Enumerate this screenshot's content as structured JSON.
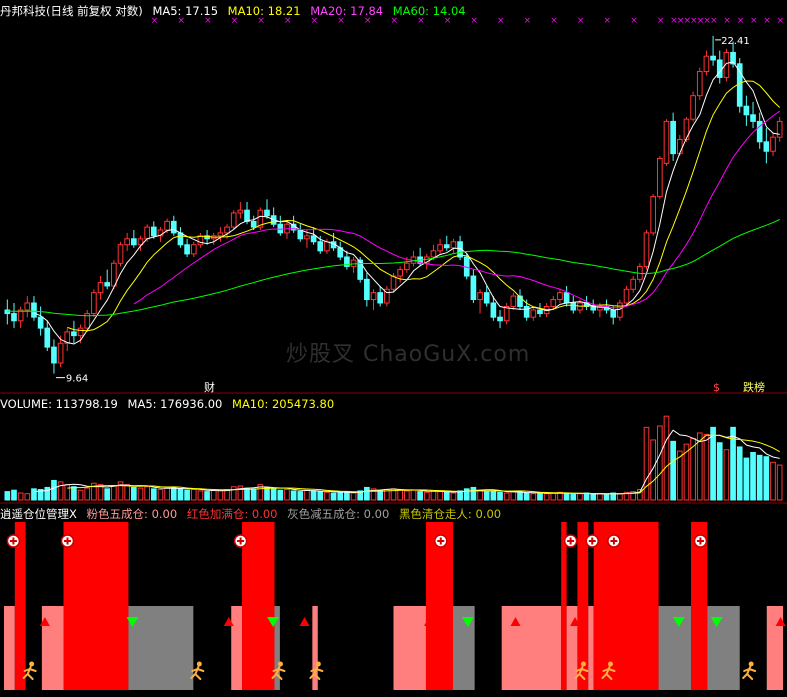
{
  "header": {
    "price_title": "丹邦科技(日线 前复权 对数)",
    "ma5": "MA5: 17.15",
    "ma10": "MA10: 18.21",
    "ma20": "MA20: 17.84",
    "ma60": "MA60: 14.04",
    "vol_title": "VOLUME: 113798.19",
    "vol_ma5": "MA5: 176936.00",
    "vol_ma10": "MA10: 205473.80",
    "ind_title": "逍遥仓位管理X",
    "ind_pink": "粉色五成仓: 0.00",
    "ind_red": "红色加满仓: 0.00",
    "ind_gray": "灰色减五成仓: 0.00",
    "ind_black": "黑色清仓走人: 0.00"
  },
  "colors": {
    "ma5": "#ffffff",
    "ma10": "#ffff00",
    "ma20": "#ff00ff",
    "ma60": "#00ff00",
    "up": "#ff3333",
    "down": "#54ffff",
    "pink": "#ff7f7f",
    "red": "#ff0000",
    "gray": "#808080",
    "divider": "#8b0000"
  },
  "chart_data": {
    "type": "candlestick",
    "scale": "log",
    "annotations": {
      "high_label": "22.41",
      "low_label": "9.64",
      "fin_label": "财",
      "dollar_label": "$",
      "tag_label": "跌榜",
      "watermark": "炒股叉 ChaoGuX.com"
    },
    "candles": [
      [
        11.3,
        11.6,
        10.9,
        11.2
      ],
      [
        11.2,
        11.5,
        10.8,
        11.0
      ],
      [
        11.0,
        11.4,
        10.8,
        11.3
      ],
      [
        11.3,
        11.7,
        11.1,
        11.5
      ],
      [
        11.5,
        11.7,
        11.0,
        11.1
      ],
      [
        11.1,
        11.4,
        10.6,
        10.8
      ],
      [
        10.8,
        11.0,
        10.2,
        10.3
      ],
      [
        10.3,
        10.5,
        9.64,
        9.9
      ],
      [
        9.9,
        10.6,
        9.8,
        10.4
      ],
      [
        10.4,
        10.8,
        10.2,
        10.7
      ],
      [
        10.7,
        11.0,
        10.4,
        10.6
      ],
      [
        10.6,
        10.9,
        10.4,
        10.8
      ],
      [
        10.8,
        11.3,
        10.7,
        11.2
      ],
      [
        11.2,
        11.9,
        11.1,
        11.8
      ],
      [
        11.8,
        12.3,
        11.6,
        12.1
      ],
      [
        12.1,
        12.5,
        11.9,
        12.0
      ],
      [
        12.0,
        12.8,
        11.9,
        12.7
      ],
      [
        12.7,
        13.4,
        12.6,
        13.3
      ],
      [
        13.3,
        13.7,
        13.1,
        13.5
      ],
      [
        13.5,
        13.8,
        13.2,
        13.3
      ],
      [
        13.3,
        13.6,
        13.1,
        13.5
      ],
      [
        13.5,
        14.0,
        13.4,
        13.9
      ],
      [
        13.9,
        14.1,
        13.5,
        13.6
      ],
      [
        13.6,
        13.9,
        13.4,
        13.8
      ],
      [
        13.8,
        14.2,
        13.7,
        14.1
      ],
      [
        14.1,
        14.3,
        13.6,
        13.7
      ],
      [
        13.7,
        13.9,
        13.2,
        13.3
      ],
      [
        13.3,
        13.5,
        12.9,
        13.0
      ],
      [
        13.0,
        13.4,
        12.9,
        13.3
      ],
      [
        13.3,
        13.7,
        13.2,
        13.6
      ],
      [
        13.6,
        13.8,
        13.3,
        13.5
      ],
      [
        13.5,
        13.7,
        13.3,
        13.6
      ],
      [
        13.6,
        13.9,
        13.4,
        13.7
      ],
      [
        13.7,
        14.0,
        13.5,
        13.9
      ],
      [
        13.9,
        14.5,
        13.8,
        14.4
      ],
      [
        14.4,
        14.8,
        14.2,
        14.5
      ],
      [
        14.5,
        14.8,
        14.0,
        14.1
      ],
      [
        14.1,
        14.3,
        13.8,
        13.9
      ],
      [
        13.9,
        14.6,
        13.8,
        14.5
      ],
      [
        14.5,
        14.9,
        14.2,
        14.3
      ],
      [
        14.3,
        14.6,
        13.9,
        14.0
      ],
      [
        14.0,
        14.3,
        13.6,
        13.7
      ],
      [
        13.7,
        14.1,
        13.5,
        14.0
      ],
      [
        14.0,
        14.3,
        13.7,
        13.8
      ],
      [
        13.8,
        14.0,
        13.4,
        13.5
      ],
      [
        13.5,
        13.8,
        13.2,
        13.6
      ],
      [
        13.6,
        13.9,
        13.3,
        13.4
      ],
      [
        13.4,
        13.6,
        13.0,
        13.1
      ],
      [
        13.1,
        13.5,
        13.0,
        13.4
      ],
      [
        13.4,
        13.7,
        13.1,
        13.2
      ],
      [
        13.2,
        13.4,
        12.8,
        12.9
      ],
      [
        12.9,
        13.1,
        12.5,
        12.6
      ],
      [
        12.6,
        12.9,
        12.4,
        12.8
      ],
      [
        12.8,
        12.9,
        12.1,
        12.2
      ],
      [
        12.2,
        12.4,
        11.4,
        11.6
      ],
      [
        11.6,
        11.9,
        11.3,
        11.8
      ],
      [
        11.8,
        12.0,
        11.4,
        11.5
      ],
      [
        11.5,
        12.0,
        11.4,
        11.9
      ],
      [
        11.9,
        12.4,
        11.8,
        12.3
      ],
      [
        12.3,
        12.6,
        12.1,
        12.5
      ],
      [
        12.5,
        12.9,
        12.4,
        12.7
      ],
      [
        12.7,
        13.1,
        12.6,
        12.9
      ],
      [
        12.9,
        13.2,
        12.6,
        12.7
      ],
      [
        12.7,
        13.0,
        12.5,
        12.9
      ],
      [
        12.9,
        13.3,
        12.8,
        13.1
      ],
      [
        13.1,
        13.5,
        13.0,
        13.3
      ],
      [
        13.3,
        13.6,
        13.1,
        13.2
      ],
      [
        13.2,
        13.5,
        13.0,
        13.4
      ],
      [
        13.4,
        13.6,
        12.8,
        12.9
      ],
      [
        12.9,
        13.0,
        12.2,
        12.3
      ],
      [
        12.3,
        12.5,
        11.5,
        11.6
      ],
      [
        11.6,
        11.9,
        11.2,
        11.8
      ],
      [
        11.8,
        12.0,
        11.4,
        11.5
      ],
      [
        11.5,
        11.7,
        11.0,
        11.1
      ],
      [
        11.1,
        11.3,
        10.8,
        11.0
      ],
      [
        11.0,
        11.5,
        10.9,
        11.4
      ],
      [
        11.4,
        11.8,
        11.3,
        11.7
      ],
      [
        11.7,
        11.9,
        11.3,
        11.4
      ],
      [
        11.4,
        11.6,
        11.0,
        11.1
      ],
      [
        11.1,
        11.4,
        11.0,
        11.3
      ],
      [
        11.3,
        11.5,
        11.1,
        11.2
      ],
      [
        11.2,
        11.5,
        11.1,
        11.4
      ],
      [
        11.4,
        11.7,
        11.3,
        11.6
      ],
      [
        11.6,
        11.9,
        11.5,
        11.8
      ],
      [
        11.8,
        12.0,
        11.4,
        11.5
      ],
      [
        11.5,
        11.7,
        11.2,
        11.3
      ],
      [
        11.3,
        11.6,
        11.2,
        11.5
      ],
      [
        11.5,
        11.7,
        11.3,
        11.4
      ],
      [
        11.4,
        11.6,
        11.2,
        11.3
      ],
      [
        11.3,
        11.5,
        11.1,
        11.4
      ],
      [
        11.4,
        11.6,
        11.2,
        11.3
      ],
      [
        11.3,
        11.4,
        10.9,
        11.1
      ],
      [
        11.1,
        11.6,
        11.0,
        11.5
      ],
      [
        11.5,
        12.0,
        11.4,
        11.9
      ],
      [
        11.9,
        12.3,
        11.8,
        12.2
      ],
      [
        12.2,
        12.7,
        12.1,
        12.6
      ],
      [
        12.6,
        13.8,
        12.5,
        13.7
      ],
      [
        13.7,
        15.1,
        13.6,
        15.0
      ],
      [
        15.0,
        16.6,
        14.9,
        16.5
      ],
      [
        16.3,
        18.2,
        16.2,
        18.1
      ],
      [
        18.1,
        18.5,
        16.4,
        16.7
      ],
      [
        16.7,
        17.5,
        16.6,
        17.3
      ],
      [
        17.3,
        18.3,
        17.2,
        18.2
      ],
      [
        18.2,
        19.5,
        18.1,
        19.3
      ],
      [
        19.3,
        20.7,
        19.1,
        20.5
      ],
      [
        20.5,
        21.6,
        20.3,
        21.3
      ],
      [
        21.3,
        22.41,
        20.8,
        21.1
      ],
      [
        21.1,
        21.6,
        19.9,
        20.2
      ],
      [
        20.2,
        21.7,
        20.0,
        21.5
      ],
      [
        21.5,
        22.1,
        20.7,
        20.9
      ],
      [
        20.9,
        21.2,
        18.5,
        18.8
      ],
      [
        18.8,
        19.3,
        17.9,
        18.4
      ],
      [
        18.4,
        19.0,
        17.8,
        18.1
      ],
      [
        18.1,
        18.5,
        16.9,
        17.2
      ],
      [
        17.2,
        17.8,
        16.3,
        16.8
      ],
      [
        16.8,
        17.6,
        16.6,
        17.4
      ],
      [
        17.4,
        18.3,
        17.2,
        18.1
      ]
    ],
    "volume": [
      60,
      70,
      50,
      45,
      80,
      75,
      90,
      140,
      130,
      110,
      95,
      70,
      85,
      120,
      110,
      80,
      100,
      130,
      110,
      90,
      85,
      95,
      80,
      75,
      85,
      90,
      80,
      70,
      75,
      65,
      60,
      70,
      65,
      75,
      95,
      100,
      85,
      80,
      110,
      90,
      80,
      70,
      75,
      65,
      60,
      70,
      65,
      60,
      55,
      50,
      55,
      60,
      50,
      65,
      90,
      80,
      70,
      75,
      80,
      70,
      65,
      70,
      60,
      55,
      65,
      60,
      55,
      50,
      65,
      80,
      90,
      70,
      60,
      65,
      55,
      50,
      60,
      55,
      50,
      45,
      50,
      45,
      50,
      55,
      45,
      40,
      45,
      50,
      40,
      45,
      40,
      50,
      45,
      55,
      60,
      75,
      520,
      430,
      530,
      600,
      420,
      350,
      400,
      440,
      480,
      470,
      520,
      410,
      360,
      520,
      380,
      300,
      340,
      320,
      310,
      270,
      250
    ],
    "bands": [
      {
        "from": 0,
        "to": 2,
        "zone": "pink"
      },
      {
        "from": 2,
        "to": 4,
        "zone": "red"
      },
      {
        "from": 4,
        "to": 7,
        "zone": "black"
      },
      {
        "from": 7,
        "to": 11,
        "zone": "pink"
      },
      {
        "from": 11,
        "to": 23,
        "zone": "red"
      },
      {
        "from": 23,
        "to": 35,
        "zone": "gray"
      },
      {
        "from": 35,
        "to": 42,
        "zone": "black"
      },
      {
        "from": 42,
        "to": 44,
        "zone": "pink"
      },
      {
        "from": 44,
        "to": 50,
        "zone": "red"
      },
      {
        "from": 50,
        "to": 51,
        "zone": "gray"
      },
      {
        "from": 51,
        "to": 57,
        "zone": "black"
      },
      {
        "from": 57,
        "to": 58,
        "zone": "pink"
      },
      {
        "from": 58,
        "to": 72,
        "zone": "black"
      },
      {
        "from": 72,
        "to": 78,
        "zone": "pink"
      },
      {
        "from": 78,
        "to": 83,
        "zone": "red"
      },
      {
        "from": 83,
        "to": 87,
        "zone": "gray"
      },
      {
        "from": 87,
        "to": 92,
        "zone": "black"
      },
      {
        "from": 92,
        "to": 103,
        "zone": "pink"
      },
      {
        "from": 103,
        "to": 104,
        "zone": "red"
      },
      {
        "from": 104,
        "to": 106,
        "zone": "pink"
      },
      {
        "from": 106,
        "to": 108,
        "zone": "red"
      },
      {
        "from": 108,
        "to": 109,
        "zone": "pink"
      },
      {
        "from": 109,
        "to": 121,
        "zone": "red"
      },
      {
        "from": 121,
        "to": 127,
        "zone": "gray"
      },
      {
        "from": 127,
        "to": 130,
        "zone": "red"
      },
      {
        "from": 130,
        "to": 136,
        "zone": "gray"
      },
      {
        "from": 136,
        "to": 141,
        "zone": "black"
      },
      {
        "from": 141,
        "to": 144,
        "zone": "pink"
      }
    ],
    "signals_plus": [
      1,
      11,
      43,
      80,
      104,
      108,
      112,
      128
    ],
    "signals_up": [
      7,
      41,
      55,
      78,
      94,
      105,
      143
    ],
    "signals_down": [
      23,
      49,
      85,
      124,
      131
    ],
    "signals_runner": [
      4,
      35,
      50,
      57,
      106,
      111,
      137
    ]
  }
}
